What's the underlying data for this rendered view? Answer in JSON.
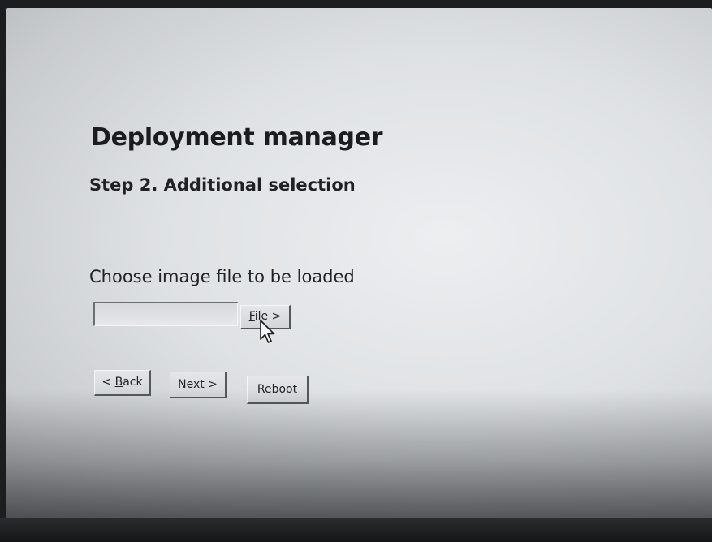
{
  "page": {
    "title": "Deployment manager",
    "subtitle": "Step 2. Additional selection",
    "prompt": "Choose image file to be loaded"
  },
  "file_picker": {
    "value": "",
    "button_prefix": "",
    "button_mnemonic": "F",
    "button_rest": "ile >"
  },
  "nav": {
    "back_prefix": "< ",
    "back_mnemonic": "B",
    "back_rest": "ack",
    "next_mnemonic": "N",
    "next_rest": "ext >",
    "reboot_mnemonic": "R",
    "reboot_rest": "eboot"
  },
  "icons": {
    "cursor": "mouse-pointer-icon"
  },
  "colors": {
    "screen_bg": "#e3e6e8",
    "text": "#1a1c1e",
    "button_face": "#dcdfe2",
    "button_shadow": "#55585b"
  }
}
